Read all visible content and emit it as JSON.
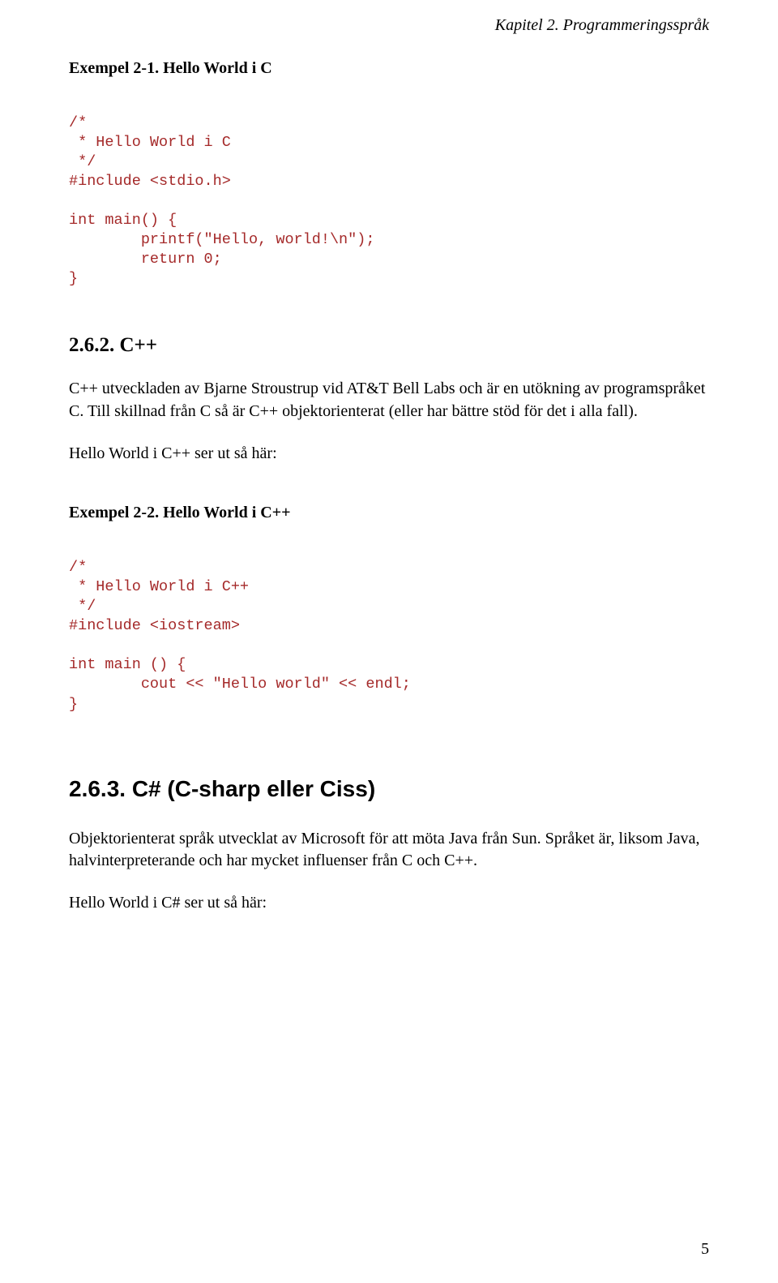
{
  "chapter_header": "Kapitel 2. Programmeringsspråk",
  "example1": {
    "title": "Exempel 2-1. Hello World i C",
    "code": "/*\n * Hello World i C\n */\n#include <stdio.h>\n\nint main() {\n        printf(\"Hello, world!\\n\");\n        return 0;\n}"
  },
  "section_cpp": {
    "heading": "2.6.2. C++",
    "para1": "C++ utveckladen av Bjarne Stroustrup vid AT&T Bell Labs och är en utökning av programspråket C. Till skillnad från C så är C++ objektorienterat (eller har bättre stöd för det i alla fall).",
    "para2": "Hello World i C++ ser ut så här:"
  },
  "example2": {
    "title": "Exempel 2-2. Hello World i C++",
    "code": "/*\n * Hello World i C++\n */\n#include <iostream>\n\nint main () {\n        cout << \"Hello world\" << endl;\n}"
  },
  "section_csharp": {
    "heading": "2.6.3. C# (C-sharp eller Ciss)",
    "para1": "Objektorienterat språk utvecklat av Microsoft för att möta Java från Sun. Språket är, liksom Java, halvinterpreterande och har mycket influenser från C och C++.",
    "para2": "Hello World i C# ser ut så här:"
  },
  "page_number": "5"
}
